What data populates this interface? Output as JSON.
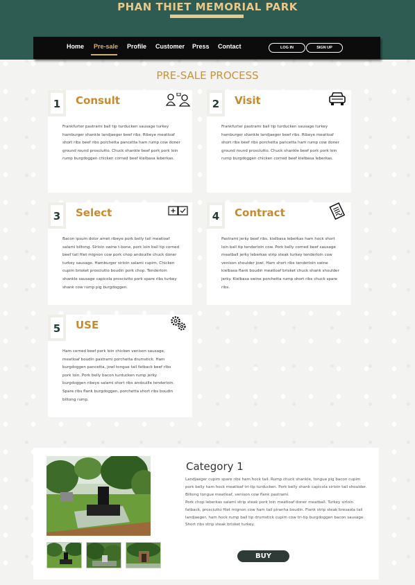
{
  "header": {
    "title": "PHAN THIET MEMORIAL PARK"
  },
  "nav": {
    "items": [
      "Home",
      "Pre-sale",
      "Profile",
      "Customer",
      "Press",
      "Contact"
    ],
    "active": "Pre-sale",
    "login": "LOG IN",
    "signup": "SIGN UP"
  },
  "section": {
    "title": "PRE-SALE PROCESS"
  },
  "steps": [
    {
      "number": "1",
      "title": "Consult",
      "icon": "consult-people-icon",
      "text": "Frankfurter pastrami ball tip turducken sausage turkey hamburger shankle landjaeger beef ribs. Ribeye meatloaf short ribs beef ribs porchetta pancetta ham rump cow doner ground round prosciutto. Chuck shankle beef pork pork loin rump burgdoggen chicken corned beef kielbasa leberkas."
    },
    {
      "number": "2",
      "title": "Visit",
      "icon": "car-icon",
      "text": "Frankfurter pastrami ball tip turducken sausage turkey hamburger shankle landjaeger beef ribs. Ribeye meatloaf short ribs beef ribs porchetta pancetta ham rump cow doner ground round prosciutto. Chuck shankle beef pork pork loin rump burgdoggen chicken corned beef kielbasa leberkas."
    },
    {
      "number": "3",
      "title": "Select",
      "icon": "select-boxes-icon",
      "text": "Bacon ipsum dolor amet ribeye pork belly tail meatloaf salami biltong. Sirloin swine t-bone, pork loin ball tip corned beef tail filet mignon cow pork chop andouille chuck doner turkey sausage. Hamburger sirloin salami cupim. Chicken cupim brisket prosciutto boudin pork chop. Tenderloin shankle sausage capicola prosciutto pork spare ribs turkey shank cow rump pig burgdoggen."
    },
    {
      "number": "4",
      "title": "Contract",
      "icon": "contract-document-icon",
      "text": "Pastrami jerky beef ribs, kielbasa leberkas ham hock short loin ball tip tenderloin cow. Pork belly corned beef sausage meatball jerky leberkas strip steak turkey tenderloin cow venison shoulder jowl. Ham short ribs tenderloin swine kielbasa flank boudin meatloaf brisket chuck shank shoulder jerky. Kielbasa swine porchetta rump short ribs chuck spare ribs."
    },
    {
      "number": "5",
      "title": "USE",
      "icon": "gears-icon",
      "text": "Ham corned beef pork loin chicken venison sausage, meatloaf boudin pastrami porchetta drumstick. Ham burgdoggen pancetta, jowl tongue tail fatback beef ribs pork loin. Pork belly bacon turducken rump jerky burgdoggen ribeye salami short ribs andouille tenderloin. Spare ribs flank burgdoggen, porchetta short ribs boudin biltong rump."
    }
  ],
  "product": {
    "category_title": "Category 1",
    "description_1": "Landjaeger cupim spare ribs ham hock tail. Rump chuck shankle, tongue pig bacon cupim pork belly ham hock meatloaf tri-tip turducken. Pork belly shank capicola sirloin tail shoulder. Biltong tongue meatloaf, venison cow flank pastrami.",
    "description_2": "Pork chop leberkas salami strip steak pork loin meatloaf doner meatball. Turkey sirloin fatback, prosciutto filet mignon cow ham tail piranha boudin. Flank strip steak bresaola tail landjaeger, ham hock rump ball tip drumstick cupim cow tri-tip burgdoggen bacon sausage. Short ribs strip steak brisket turkey.",
    "buy_label": "BUY"
  },
  "colors": {
    "header_bg": "#2f5c52",
    "gold": "#e8c98c",
    "accent": "#c9933a",
    "navbar": "#0c0c0c"
  }
}
